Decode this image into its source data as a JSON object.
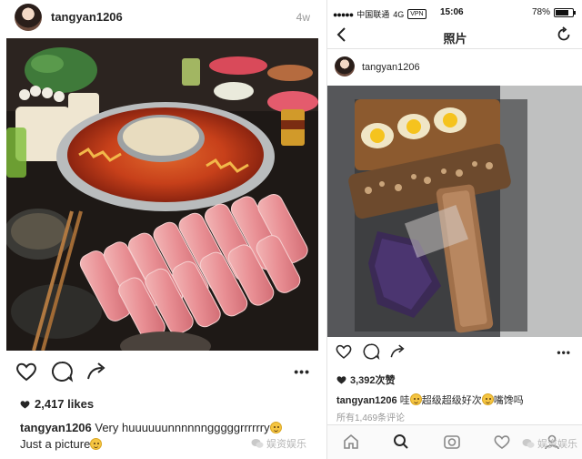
{
  "left_post": {
    "username": "tangyan1206",
    "timestamp": "4w",
    "likes": "2,417 likes",
    "caption": {
      "username": "tangyan1206",
      "text": " Very huuuuuunnnnnngggggrrrrrry",
      "line2": "Just a picture"
    },
    "icons": [
      "heart-icon",
      "comment-icon",
      "share-icon",
      "more-icon"
    ],
    "more_label": "•••"
  },
  "right_phone": {
    "status": {
      "carrier": "中国联通",
      "network": "4G",
      "vpn": "VPN",
      "time": "15:06",
      "battery": "78%",
      "battery_level": 0.78
    },
    "nav": {
      "title": "照片"
    },
    "post": {
      "username": "tangyan1206",
      "likes": "3,392次赞",
      "caption": {
        "username": "tangyan1206",
        "text": " 哇",
        "text2": "超级超级好次",
        "text3": "嘴馋吗"
      },
      "comments": "所有1,469条评论"
    },
    "tabs": [
      "home-icon",
      "search-icon",
      "camera-icon",
      "heart-icon",
      "profile-icon"
    ]
  },
  "watermarks": [
    "娱资娱乐",
    "娱资娱乐"
  ]
}
